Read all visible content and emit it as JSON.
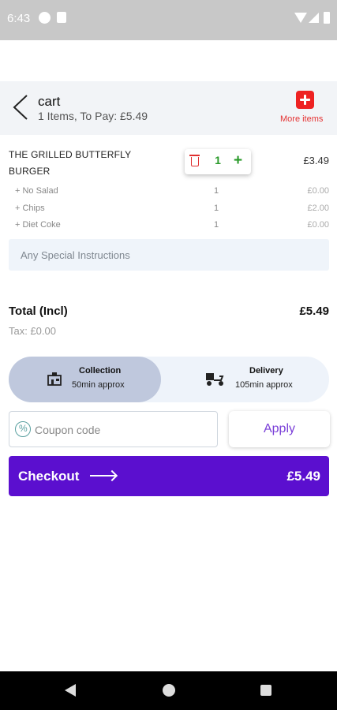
{
  "status_bar": {
    "time": "6:43"
  },
  "header": {
    "title": "cart",
    "subtitle": "1 Items, To Pay: £5.49",
    "more_items_label": "More items"
  },
  "item": {
    "name": "THE GRILLED BUTTERFLY BURGER",
    "quantity": "1",
    "price": "£3.49",
    "modifiers": [
      {
        "name": "+ No Salad",
        "qty": "1",
        "price": "£0.00"
      },
      {
        "name": "+ Chips",
        "qty": "1",
        "price": "£2.00"
      },
      {
        "name": "+ Diet Coke",
        "qty": "1",
        "price": "£0.00"
      }
    ]
  },
  "instructions": {
    "placeholder": "Any Special Instructions"
  },
  "totals": {
    "total_label": "Total (Incl)",
    "total_value": "£5.49",
    "tax": "Tax: £0.00"
  },
  "order_type": {
    "collection": {
      "title": "Collection",
      "time": "50min approx"
    },
    "delivery": {
      "title": "Delivery",
      "time": "105min approx"
    },
    "selected": "collection"
  },
  "coupon": {
    "placeholder": "Coupon code",
    "value": "",
    "apply_label": "Apply"
  },
  "checkout": {
    "label": "Checkout",
    "amount": "£5.49"
  },
  "colors": {
    "accent": "#5b0fcf",
    "danger": "#ee2222",
    "success": "#2a9a2a",
    "apply_text": "#7a3fd8"
  }
}
